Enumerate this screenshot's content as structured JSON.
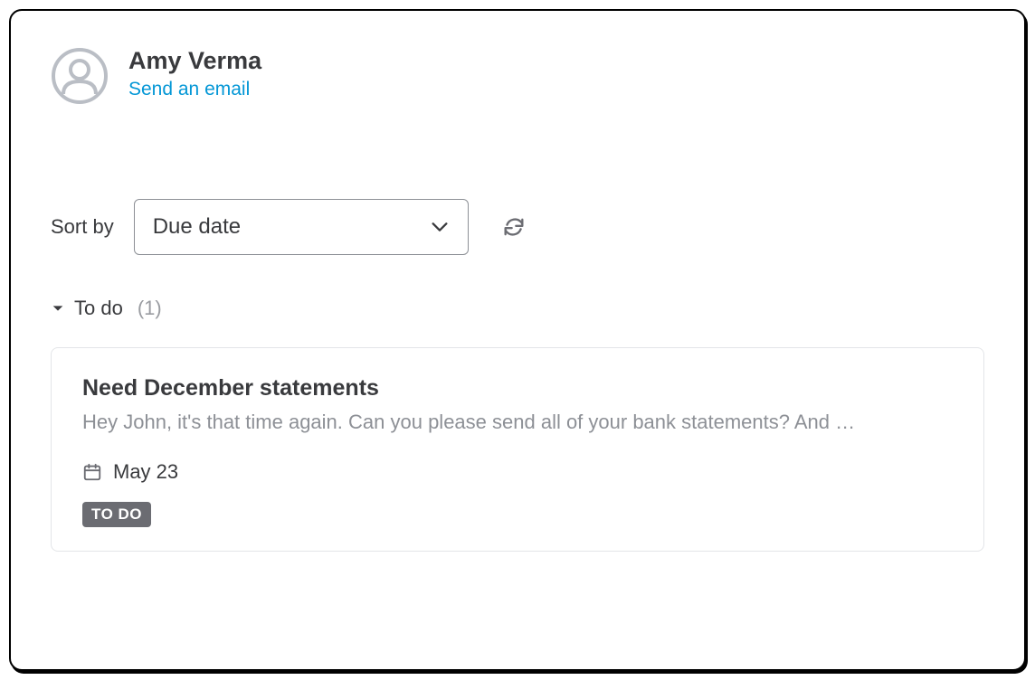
{
  "contact": {
    "name": "Amy Verma",
    "email_action": "Send an email"
  },
  "sort": {
    "label": "Sort by",
    "selected": "Due date"
  },
  "section": {
    "title": "To do",
    "count": "(1)"
  },
  "task": {
    "title": "Need December statements",
    "body": "Hey John, it's that time again. Can you please send all of your bank statements? And …",
    "date": "May 23",
    "badge": "TO DO"
  }
}
